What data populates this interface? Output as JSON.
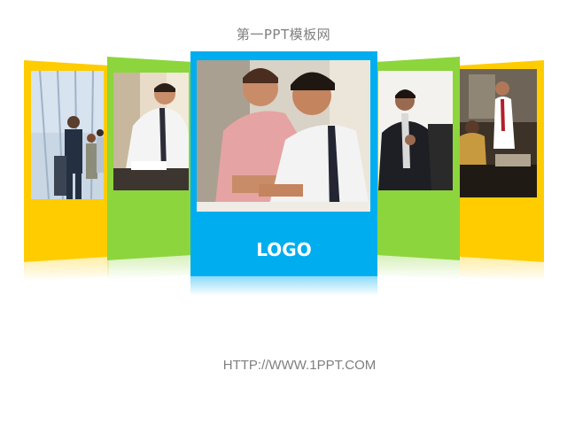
{
  "header": {
    "title": "第一PPT模板网"
  },
  "center_card": {
    "logo_text": "LOGO",
    "color": "#00aeef"
  },
  "cards": [
    {
      "name": "far-left",
      "color": "#ffcc00"
    },
    {
      "name": "left",
      "color": "#8dd53c"
    },
    {
      "name": "right",
      "color": "#8dd53c"
    },
    {
      "name": "far-right",
      "color": "#ffcc00"
    }
  ],
  "footer": {
    "url": "HTTP://WWW.1PPT.COM"
  }
}
